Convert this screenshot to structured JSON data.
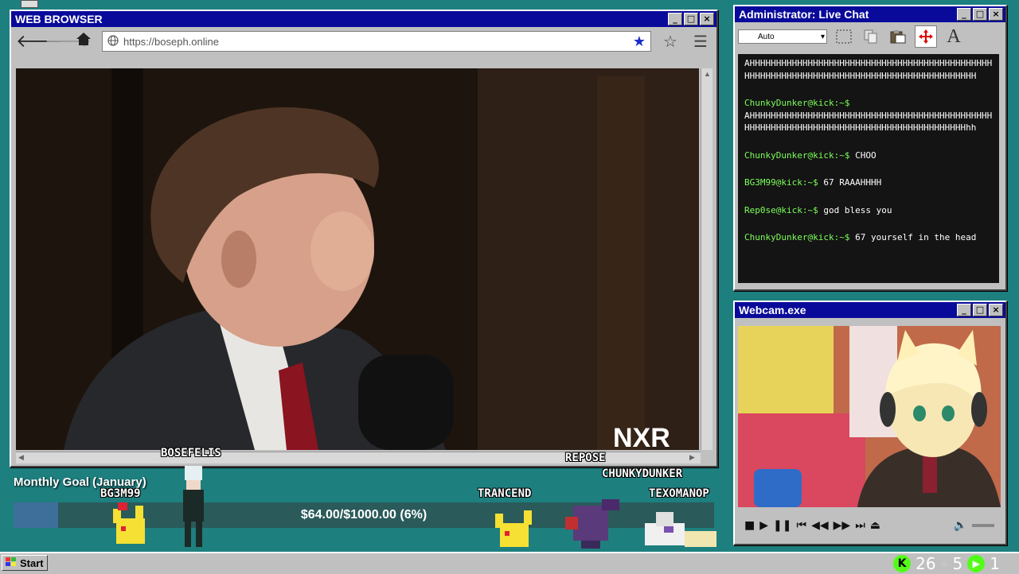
{
  "browser": {
    "title": "WEB BROWSER",
    "url": "https://boseph.online",
    "icons": {
      "back": "arrow-left-icon",
      "forward": "arrow-right-icon",
      "home": "home-icon",
      "menu": "hamburger-icon",
      "bookmark": "star-icon"
    },
    "video_watermark": "NXR"
  },
  "chat": {
    "title": "Administrator: Live Chat",
    "font_select": "Auto",
    "messages": [
      {
        "user": "",
        "text": "AHHHHHHHHHHHHHHHHHHHHHHHHHHHHHHHHHHHHHHHHHHHHHHHHHHHHHHHHHHHHHHHHHHHHHHHHHHHHHHHHHHHHHHHHHH"
      },
      {
        "user": "ChunkyDunker@kick:~$",
        "text": "AHHHHHHHHHHHHHHHHHHHHHHHHHHHHHHHHHHHHHHHHHHHHHHHHHHHHHHHHHHHHHHHHHHHHHHHHHHHHHHHHHHHHHHHHhh"
      },
      {
        "user": "ChunkyDunker@kick:~$",
        "text": "CHOO"
      },
      {
        "user": "BG3M99@kick:~$",
        "text": "67 RAAAHHHH"
      },
      {
        "user": "Rep0se@kick:~$",
        "text": "god bless you"
      },
      {
        "user": "ChunkyDunker@kick:~$",
        "text": "67 yourself in the head"
      }
    ]
  },
  "webcam": {
    "title": "Webcam.exe"
  },
  "overlay": {
    "goal_title": "Monthly Goal (January)",
    "goal_text": "$64.00/$1000.00 (6%)",
    "goal_fraction": 0.064,
    "names": {
      "bosefelis": "BOSEFELIS",
      "repose": "REPOSE",
      "chunkydunker": "CHUNKYDUNKER",
      "bg3m99": "BG3M99",
      "trancend": "TRANCEND",
      "texomanop": "TEXOMANOP"
    }
  },
  "taskbar": {
    "start_label": "Start",
    "tray_count_a": "26",
    "tray_count_b": "5",
    "tray_count_c": "1"
  },
  "colors": {
    "desktop": "#1e7f7f",
    "titlebar": "#0a0a9a",
    "kick_green": "#53fc18",
    "chat_user": "#7cff5a"
  }
}
